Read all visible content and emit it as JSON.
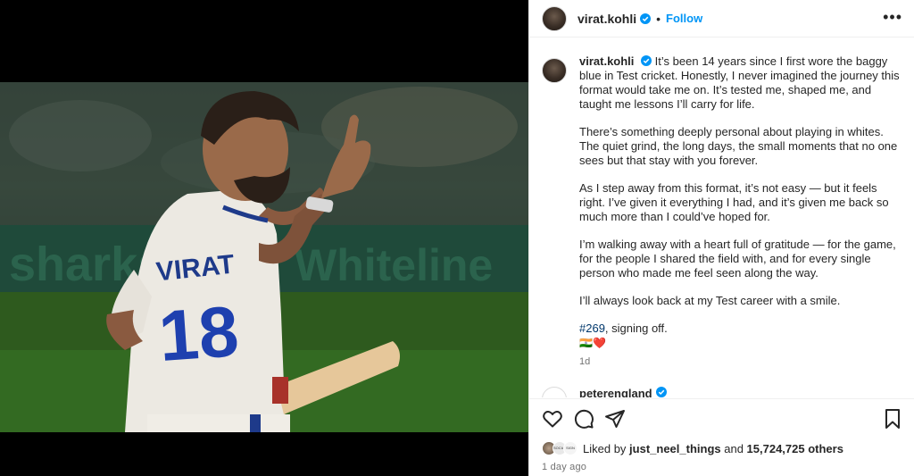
{
  "header": {
    "username": "virat.kohli",
    "dot": "•",
    "follow_label": "Follow",
    "more_label": "•••"
  },
  "media": {
    "jersey_name": "VIRAT",
    "jersey_number": "18"
  },
  "caption": {
    "username": "virat.kohli",
    "p1": "It’s been 14 years since I first wore the baggy blue in Test cricket. Honestly, I never imagined the journey this format would take me on. It’s tested me, shaped me, and taught me lessons I’ll carry for life.",
    "p2": "There’s something deeply personal about playing in whites. The quiet grind, the long days, the small moments that no one sees but that stay with you forever.",
    "p3": "As I step away from this format, it’s not easy — but it feels right. I’ve given it everything I had, and it’s given me back so much more than I could’ve hoped for.",
    "p4": "I’m walking away with a heart full of gratitude — for the game, for the people I shared the field with, and for every single person who made me feel seen along the way.",
    "p5": "I’ll always look back at my Test career with a smile.",
    "hashtag": "#269",
    "signoff": ", signing off.",
    "emojis": "🇮🇳❤️",
    "age": "1d"
  },
  "comment": {
    "username": "peterengland"
  },
  "likes": {
    "prefix": "Liked by ",
    "user": "just_neel_things",
    "middle": " and ",
    "count": "15,724,725 others",
    "av2_text": "SOCIAL",
    "av3_text": "SIGN"
  },
  "posted": "1 day ago",
  "colors": {
    "link": "#0095f6",
    "verified": "#0095f6",
    "hashtag": "#00376b",
    "heart": "#ed4956"
  }
}
